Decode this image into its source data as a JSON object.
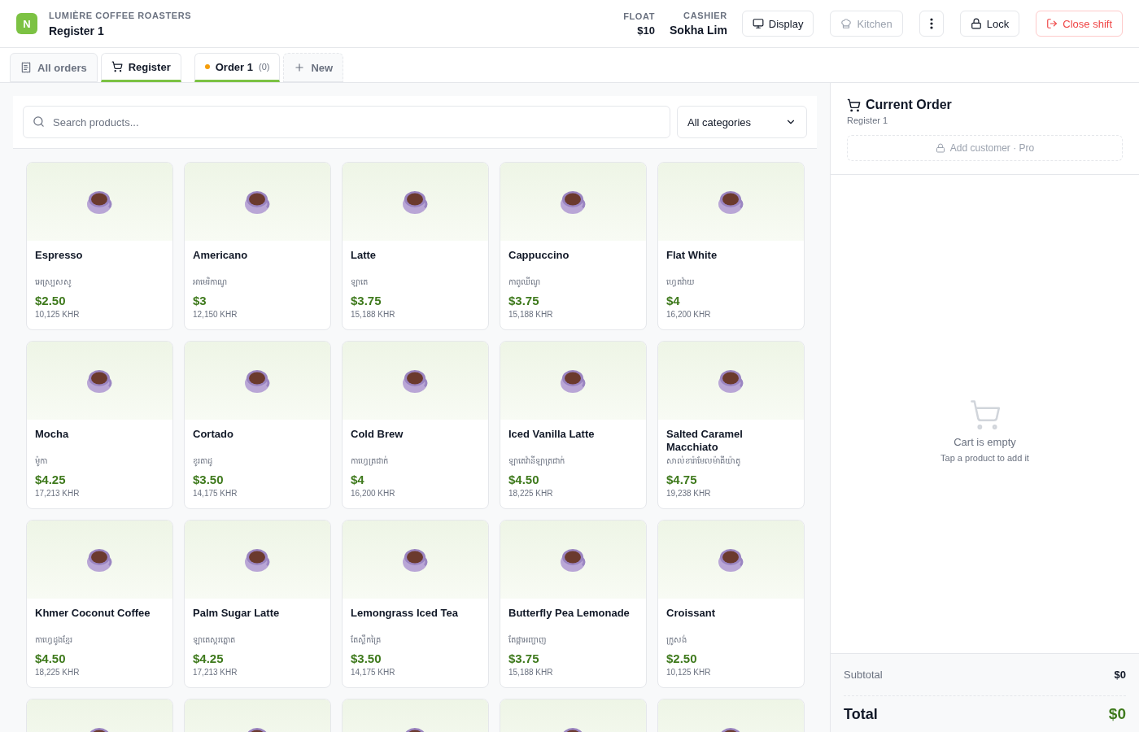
{
  "header": {
    "logo": "N",
    "business": "LUMIÈRE COFFEE ROASTERS",
    "register": "Register 1",
    "stats": [
      {
        "label": "FLOAT",
        "value": "$10",
        "kind": "float"
      },
      {
        "label": "CASHIER",
        "value": "Sokha Lim",
        "kind": "cashier"
      }
    ],
    "buttons": [
      {
        "label": "Display",
        "kind": "display",
        "disabled": false
      },
      {
        "label": "Kitchen",
        "kind": "kitchen",
        "disabled": true
      },
      {
        "kind": "more",
        "disabled": false
      },
      {
        "label": "Lock",
        "kind": "lock",
        "disabled": false
      },
      {
        "label": "Close shift",
        "kind": "close",
        "disabled": false
      }
    ]
  },
  "tabs": [
    {
      "label": "All orders",
      "kind": "view",
      "selected": false
    },
    {
      "label": "Register",
      "kind": "view",
      "selected": true
    },
    {
      "label": "Order 1",
      "count": "(0)",
      "kind": "order",
      "selected": true
    },
    {
      "label": "New",
      "kind": "new",
      "selected": false
    }
  ],
  "search": {
    "placeholder": "Search products...",
    "category": "All categories"
  },
  "products": [
    {
      "kind": "product",
      "name": "Espresso",
      "local": "អេស្រ្បសសូ",
      "price": "$2.50",
      "khr": "10,125 KHR"
    },
    {
      "kind": "product",
      "name": "Americano",
      "local": "អាមេរិកាណូ",
      "price": "$3",
      "khr": "12,150 KHR"
    },
    {
      "kind": "product",
      "name": "Latte",
      "local": "ឡាតេ",
      "price": "$3.75",
      "khr": "15,188 KHR"
    },
    {
      "kind": "product",
      "name": "Cappuccino",
      "local": "កាពូឈីណូ",
      "price": "$3.75",
      "khr": "15,188 KHR"
    },
    {
      "kind": "product",
      "name": "Flat White",
      "local": "ហ្វេតវ៉ាយ",
      "price": "$4",
      "khr": "16,200 KHR"
    },
    {
      "kind": "product",
      "name": "Mocha",
      "local": "ម៉ូកា",
      "price": "$4.25",
      "khr": "17,213 KHR"
    },
    {
      "kind": "product",
      "name": "Cortado",
      "local": "ខូរតាដូ",
      "price": "$3.50",
      "khr": "14,175 KHR"
    },
    {
      "kind": "product",
      "name": "Cold Brew",
      "local": "កាហ្វេត្រជាក់",
      "price": "$4",
      "khr": "16,200 KHR"
    },
    {
      "kind": "product",
      "name": "Iced Vanilla Latte",
      "local": "ឡាតេវ៉ានីឡាត្រជាក់",
      "price": "$4.50",
      "khr": "18,225 KHR"
    },
    {
      "kind": "product",
      "name": "Salted Caramel Macchiato",
      "local": "សាល់ខារ៉ាមែលម៉ាគីយ៉ាតូ",
      "price": "$4.75",
      "khr": "19,238 KHR"
    },
    {
      "kind": "product",
      "name": "Khmer Coconut Coffee",
      "local": "កាហ្វេដូងខ្មែរ",
      "price": "$4.50",
      "khr": "18,225 KHR"
    },
    {
      "kind": "product",
      "name": "Palm Sugar Latte",
      "local": "ឡាតេស្ករត្នោត",
      "price": "$4.25",
      "khr": "17,213 KHR"
    },
    {
      "kind": "product",
      "name": "Lemongrass Iced Tea",
      "local": "តែស្លឹកគ្រៃ",
      "price": "$3.50",
      "khr": "14,175 KHR"
    },
    {
      "kind": "product",
      "name": "Butterfly Pea Lemonade",
      "local": "តែផ្កាអញ្ចាញ",
      "price": "$3.75",
      "khr": "15,188 KHR"
    },
    {
      "kind": "product",
      "name": "Croissant",
      "local": "ក្រូសង់",
      "price": "$2.50",
      "khr": "10,125 KHR"
    },
    {
      "kind": "cut_off"
    },
    {
      "kind": "cut_off"
    },
    {
      "kind": "cut_off"
    },
    {
      "kind": "cut_off"
    },
    {
      "kind": "cut_off"
    }
  ],
  "order": {
    "title": "Current Order",
    "subtitle": "Register 1",
    "add_customer": "Add customer · Pro",
    "empty_title": "Cart is empty",
    "empty_hint": "Tap a product to add it",
    "subtotal_label": "Subtotal",
    "subtotal": "$0",
    "total_label": "Total",
    "total": "$0"
  }
}
